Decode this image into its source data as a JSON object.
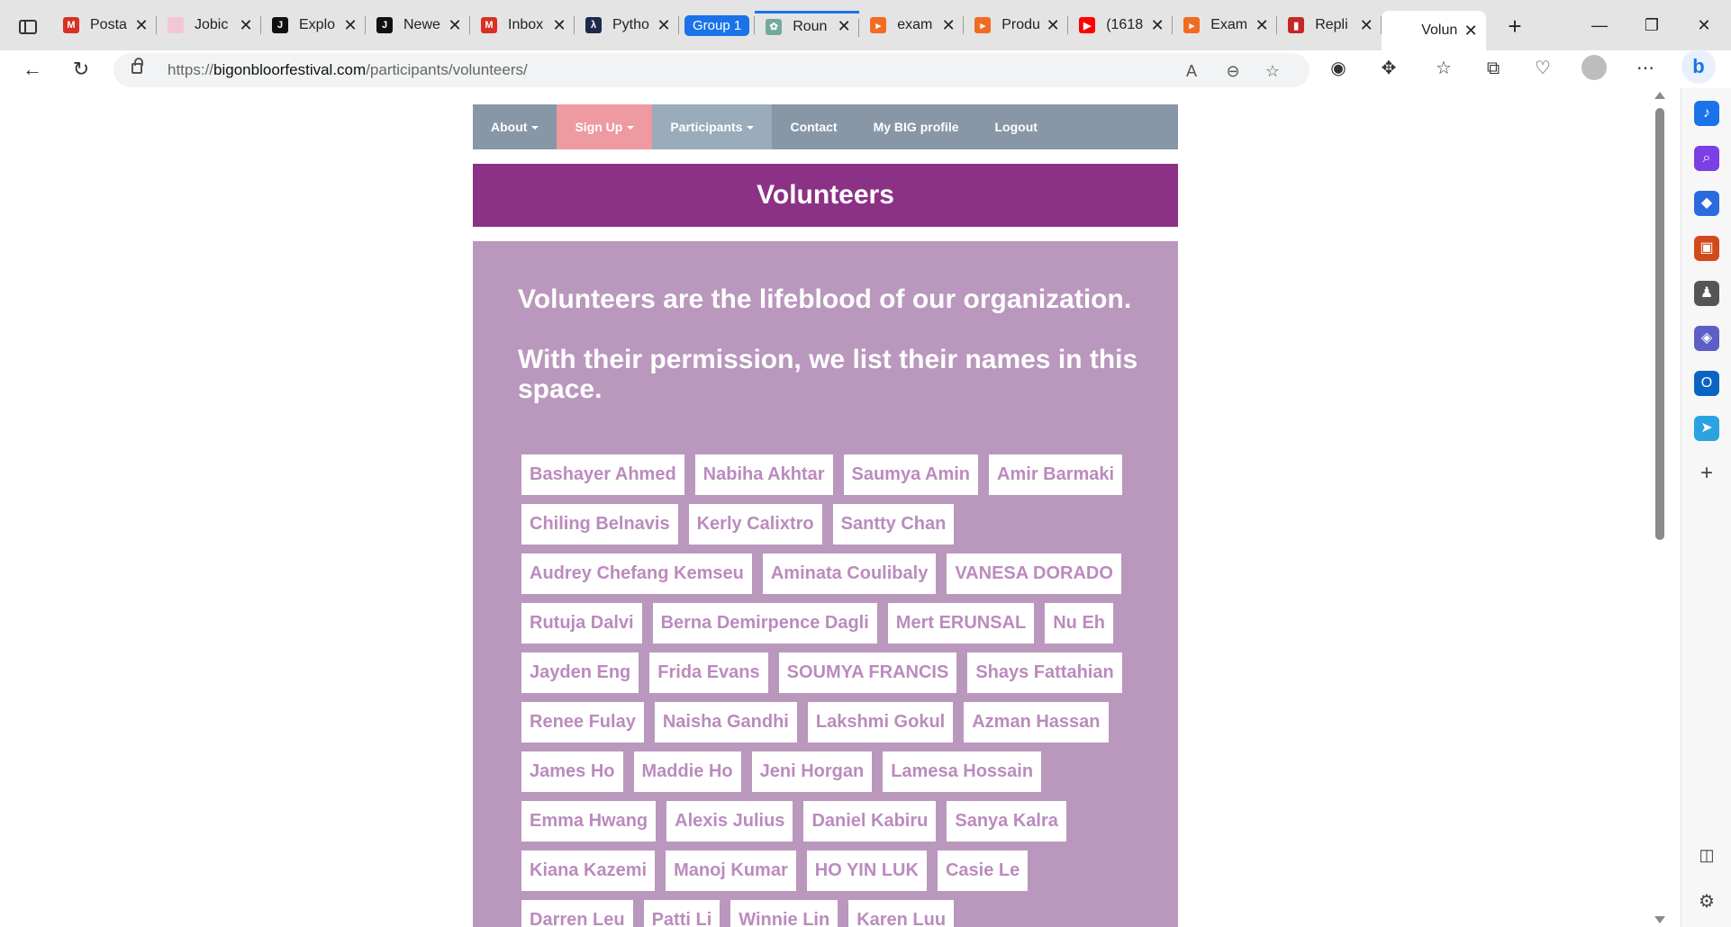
{
  "browser": {
    "tabs": [
      {
        "title": "Posta",
        "icon": "gmail-icon",
        "color": "#d93025",
        "glyph": "M",
        "group": false
      },
      {
        "title": "Jobic",
        "icon": "jobicy-icon",
        "color": "#f3c6d6",
        "glyph": "",
        "group": false
      },
      {
        "title": "Explo",
        "icon": "jobscan-icon",
        "color": "#111111",
        "glyph": "J",
        "group": false
      },
      {
        "title": "Newe",
        "icon": "jobscan-icon",
        "color": "#111111",
        "glyph": "J",
        "group": false
      },
      {
        "title": "Inbox",
        "icon": "gmail-icon",
        "color": "#d93025",
        "glyph": "M",
        "group": false
      },
      {
        "title": "Pytho",
        "icon": "pythontutor-icon",
        "color": "#1e2a4a",
        "glyph": "λ",
        "group": false
      },
      {
        "title": "Roun",
        "icon": "chatgpt-icon",
        "color": "#74aa9c",
        "glyph": "✿",
        "group": true
      },
      {
        "title": "exam",
        "icon": "scribd-icon",
        "color": "#f26b21",
        "glyph": "▸",
        "group": false
      },
      {
        "title": "Produ",
        "icon": "scribd-icon",
        "color": "#f26b21",
        "glyph": "▸",
        "group": false
      },
      {
        "title": "(1618",
        "icon": "youtube-icon",
        "color": "#ff0000",
        "glyph": "▶",
        "group": false
      },
      {
        "title": "Exam",
        "icon": "scribd-icon",
        "color": "#f26b21",
        "glyph": "▸",
        "group": false
      },
      {
        "title": "Repli",
        "icon": "chart-icon",
        "color": "#c62828",
        "glyph": "▮",
        "group": false
      }
    ],
    "group_label": "Group 1",
    "active_tab": {
      "title": "Volun"
    },
    "url_prefix": "https://",
    "url_host": "bigonbloorfestival.com",
    "url_path": "/participants/volunteers/"
  },
  "site": {
    "nav": {
      "about": "About",
      "signup": "Sign Up",
      "participants": "Participants",
      "contact": "Contact",
      "profile": "My BIG profile",
      "logout": "Logout"
    },
    "banner_title": "Volunteers",
    "intro_line1": "Volunteers are the lifeblood of our organization.",
    "intro_line2": "With their permission, we list their names in this space.",
    "volunteer_rows": [
      [
        "Bashayer Ahmed",
        "Nabiha Akhtar",
        "Saumya Amin",
        "Amir Barmaki"
      ],
      [
        "Chiling Belnavis",
        "Kerly Calixtro",
        "Santty Chan"
      ],
      [
        "Audrey Chefang Kemseu",
        "Aminata Coulibaly",
        "VANESA DORADO"
      ],
      [
        "Rutuja Dalvi",
        "Berna Demirpence Dagli",
        "Mert ERUNSAL",
        "Nu Eh"
      ],
      [
        "Jayden Eng",
        "Frida Evans",
        "SOUMYA FRANCIS",
        "Shays Fattahian"
      ],
      [
        "Renee Fulay",
        "Naisha Gandhi",
        "Lakshmi Gokul",
        "Azman Hassan"
      ],
      [
        "James Ho",
        "Maddie Ho",
        "Jeni Horgan",
        "Lamesa Hossain"
      ],
      [
        "Emma Hwang",
        "Alexis Julius",
        "Daniel Kabiru",
        "Sanya Kalra"
      ],
      [
        "Kiana Kazemi",
        "Manoj Kumar",
        "HO YIN LUK",
        "Casie Le"
      ],
      [
        "Darren Leu",
        "Patti Li",
        "Winnie Lin",
        "Karen Luu"
      ]
    ]
  }
}
